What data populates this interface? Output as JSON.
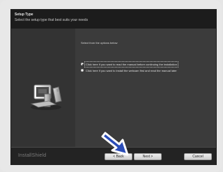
{
  "window": {
    "title": "Setup Type",
    "subtitle": "Select the setup type that best suits your needs"
  },
  "content": {
    "instruction": "Select from the options below",
    "options": [
      {
        "label": "Click here if you want to read the manual before continuing the installation",
        "selected": true
      },
      {
        "label": "Click here if you want to install the webcam first and read the manual later",
        "selected": false
      }
    ]
  },
  "footer": {
    "brand": "InstallShield",
    "buttons": {
      "back": "< Back",
      "next": "Next >",
      "cancel": "Cancel"
    }
  },
  "icons": {
    "computer": "computer-icon",
    "arrow": "pointer-arrow-icon",
    "radio": "radio-icon"
  }
}
